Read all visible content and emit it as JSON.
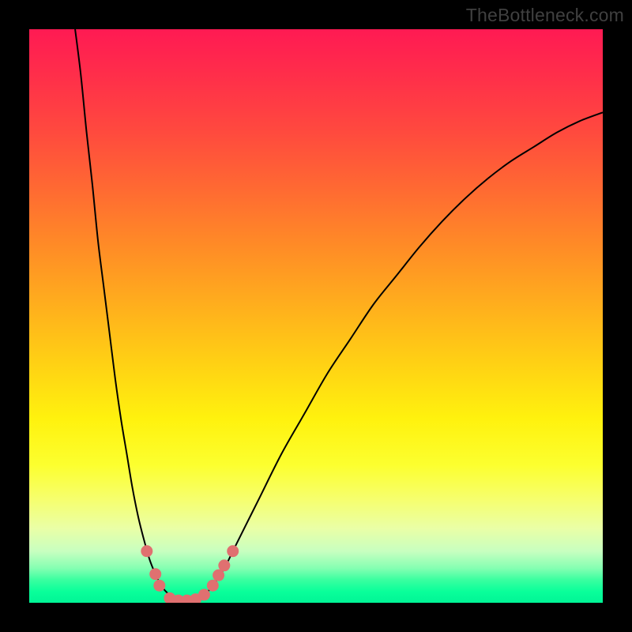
{
  "credit": "TheBottleneck.com",
  "colors": {
    "marker": "#e07070",
    "curve": "#000000"
  },
  "chart_data": {
    "type": "line",
    "title": "",
    "xlabel": "",
    "ylabel": "",
    "xlim": [
      0,
      100
    ],
    "ylim": [
      0,
      100
    ],
    "series": [
      {
        "name": "bottleneck-curve",
        "x": [
          8,
          9,
          10,
          11,
          12,
          13,
          14,
          15,
          16,
          17,
          18,
          19,
          20,
          21,
          22,
          23,
          24,
          25,
          26,
          27,
          28,
          29,
          30,
          31,
          32,
          34,
          36,
          38,
          40,
          44,
          48,
          52,
          56,
          60,
          64,
          68,
          72,
          76,
          80,
          84,
          88,
          92,
          96,
          100
        ],
        "y": [
          100,
          92,
          82,
          73,
          63,
          55,
          47,
          39,
          32,
          26,
          20,
          15,
          11,
          7.5,
          5,
          3,
          1.8,
          1,
          0.5,
          0.3,
          0.3,
          0.5,
          1,
          1.8,
          3,
          6,
          10,
          14,
          18,
          26,
          33,
          40,
          46,
          52,
          57,
          62,
          66.5,
          70.5,
          74,
          77,
          79.5,
          82,
          84,
          85.5
        ]
      }
    ],
    "markers": {
      "name": "highlight-points",
      "points": [
        {
          "x": 20.5,
          "y": 9
        },
        {
          "x": 22,
          "y": 5
        },
        {
          "x": 22.7,
          "y": 3
        },
        {
          "x": 24.5,
          "y": 0.8
        },
        {
          "x": 26,
          "y": 0.4
        },
        {
          "x": 27.5,
          "y": 0.4
        },
        {
          "x": 29,
          "y": 0.6
        },
        {
          "x": 30.5,
          "y": 1.4
        },
        {
          "x": 32,
          "y": 3
        },
        {
          "x": 33,
          "y": 4.8
        },
        {
          "x": 34,
          "y": 6.5
        },
        {
          "x": 35.5,
          "y": 9
        }
      ]
    }
  }
}
